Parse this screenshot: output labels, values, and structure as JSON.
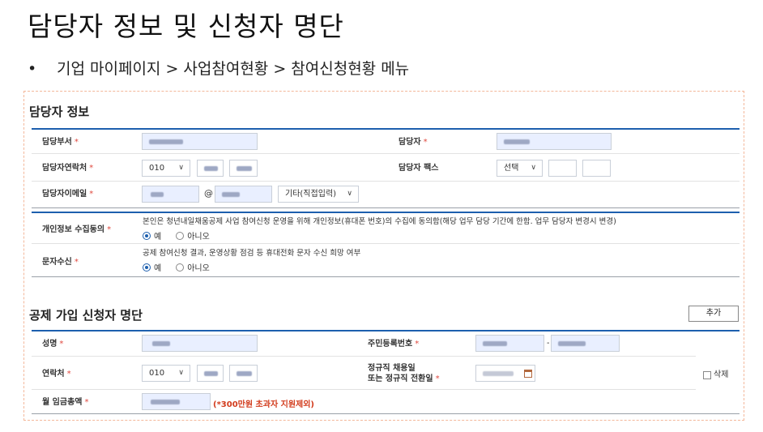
{
  "slide": {
    "title": "담당자 정보 및 신청자 명단",
    "bullet": "기업 마이페이지 > 사업참여현황 > 참여신청현황 메뉴"
  },
  "manager_section": {
    "title": "담당자 정보",
    "dept_label": "담당부서",
    "name_label": "담당자",
    "phone_label": "담당자연락처",
    "phone_prefix": "010",
    "fax_label": "담당자 팩스",
    "fax_select": "선택",
    "email_label": "담당자이메일",
    "email_at": "@",
    "email_domain_select": "기타(직접입력)",
    "required_mark": "*"
  },
  "consent": {
    "privacy_label": "개인정보 수집동의",
    "privacy_text": "본인은 청년내일채움공제 사업 참여신청 운영을 위해 개인정보(휴대폰 번호)의 수집에 동의함(해당 업무 담당 기간에 한함. 업무 담당자 변경시 변경)",
    "sms_label": "문자수신",
    "sms_text": "공제 참여신청 결과, 운영상황 점검 등 휴대전화 문자 수신 희망 여부",
    "yes": "예",
    "no": "아니오"
  },
  "applicant_section": {
    "title": "공제 가입 신청자 명단",
    "add_button": "추가",
    "name_label": "성명",
    "rrn_label": "주민등록번호",
    "rrn_dash": "-",
    "phone_label": "연락처",
    "phone_prefix": "010",
    "hire_date_label_1": "정규직 채용일",
    "hire_date_label_2": "또는 정규직 전환일",
    "delete_label": "삭제",
    "salary_label": "월 임금총액",
    "salary_note": "(*300만원 초과자 지원제외)"
  },
  "colors": {
    "accent": "#1d5fae",
    "required": "#e0483e",
    "note": "#d23b1c",
    "panel_border": "#f3b79a"
  }
}
